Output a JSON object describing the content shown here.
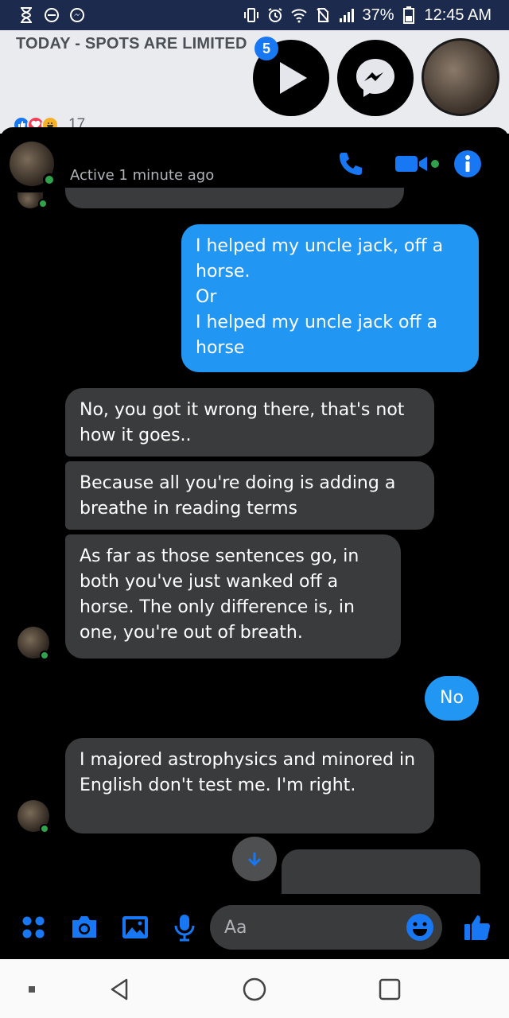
{
  "status_bar": {
    "battery": "37%",
    "time": "12:45 AM"
  },
  "feed": {
    "post_title": "TODAY - SPOTS ARE LIMITED",
    "reaction_count": "17"
  },
  "chat_heads": {
    "unread_badge": "5"
  },
  "chat": {
    "contact_name": "",
    "status": "Active 1 minute ago",
    "messages": [
      {
        "direction": "out",
        "text": "I helped my uncle jack, off a horse.\nOr\nI helped my uncle jack off a horse"
      },
      {
        "direction": "in",
        "text": "No, you got it wrong there, that's not how it goes.."
      },
      {
        "direction": "in",
        "text": "Because all you're doing is adding a breathe in reading terms"
      },
      {
        "direction": "in",
        "text": "As far as those sentences go, in both you've just wanked off a horse. The only difference is, in one, you're out of breath."
      },
      {
        "direction": "out",
        "text": "No"
      },
      {
        "direction": "in",
        "text": "I majored astrophysics and minored in English don't test me. I'm right."
      }
    ]
  },
  "composer": {
    "placeholder": "Aa"
  },
  "colors": {
    "accent": "#1877f2",
    "outgoing_bubble": "#2196f3",
    "incoming_bubble": "#3a3b3c",
    "online": "#31a24c"
  },
  "icons": [
    "hourglass-icon",
    "minus-circle-icon",
    "messenger-icon",
    "vibrate-icon",
    "alarm-icon",
    "wifi-icon",
    "no-sim-icon",
    "signal-icon",
    "battery-icon",
    "play-icon",
    "phone-icon",
    "video-icon",
    "info-icon",
    "arrow-down-icon",
    "apps-icon",
    "camera-icon",
    "gallery-icon",
    "mic-icon",
    "emoji-icon",
    "thumbs-up-icon",
    "back-icon",
    "home-icon",
    "recents-icon"
  ]
}
